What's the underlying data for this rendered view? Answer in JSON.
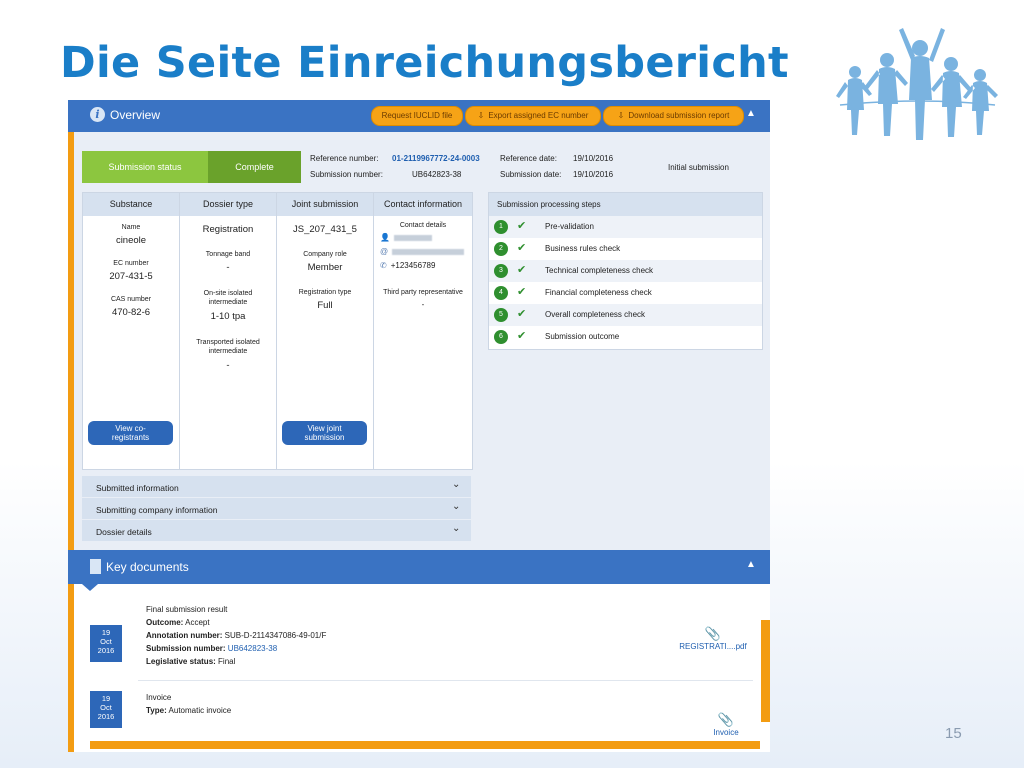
{
  "slide": {
    "title": "Die Seite Einreichungsbericht",
    "page_number": "15"
  },
  "overview": {
    "title": "Overview",
    "buttons": [
      "Request IUCLID file",
      "Export assigned EC number",
      "Download submission report"
    ],
    "status_label": "Submission status",
    "status_value": "Complete",
    "reference_number_label": "Reference number:",
    "reference_number": "01-2119967772-24-0003",
    "submission_number_label": "Submission number:",
    "submission_number": "UB642823-38",
    "reference_date_label": "Reference date:",
    "reference_date": "19/10/2016",
    "submission_date_label": "Submission date:",
    "submission_date": "19/10/2016",
    "submission_kind": "Initial submission"
  },
  "table": {
    "headers": [
      "Substance",
      "Dossier type",
      "Joint submission",
      "Contact information"
    ],
    "substance": {
      "name_label": "Name",
      "name": "cineole",
      "ec_label": "EC number",
      "ec": "207-431-5",
      "cas_label": "CAS number",
      "cas": "470-82-6",
      "button": "View co-registrants"
    },
    "dossier": {
      "type": "Registration",
      "tonnage_label": "Tonnage band",
      "tonnage": "-",
      "onsite_label": "On-site isolated intermediate",
      "onsite": "1-10 tpa",
      "transported_label": "Transported isolated intermediate",
      "transported": "-"
    },
    "joint": {
      "id": "JS_207_431_5",
      "role_label": "Company role",
      "role": "Member",
      "reg_type_label": "Registration type",
      "reg_type": "Full",
      "button": "View joint submission"
    },
    "contact": {
      "details_label": "Contact details",
      "phone": "+123456789",
      "third_party_label": "Third party representative",
      "third_party": "-"
    }
  },
  "accordions": [
    "Submitted information",
    "Submitting company information",
    "Dossier details"
  ],
  "steps": {
    "title": "Submission processing steps",
    "items": [
      {
        "num": "1",
        "label": "Pre-validation"
      },
      {
        "num": "2",
        "label": "Business rules check"
      },
      {
        "num": "3",
        "label": "Technical completeness check"
      },
      {
        "num": "4",
        "label": "Financial completeness check"
      },
      {
        "num": "5",
        "label": "Overall completeness check"
      },
      {
        "num": "6",
        "label": "Submission outcome"
      }
    ]
  },
  "key_documents": {
    "title": "Key documents",
    "doc1": {
      "day": "19",
      "month": "Oct",
      "year": "2016",
      "title": "Final submission result",
      "outcome_label": "Outcome:",
      "outcome": "Accept",
      "annotation_label": "Annotation number:",
      "annotation": "SUB-D-2114347086-49-01/F",
      "submission_label": "Submission number:",
      "submission": "UB642823-38",
      "legislative_label": "Legislative status:",
      "legislative": "Final",
      "attachment": "REGISTRATI....pdf"
    },
    "doc2": {
      "day": "19",
      "month": "Oct",
      "year": "2016",
      "title": "Invoice",
      "type_label": "Type:",
      "type": "Automatic invoice",
      "attachment": "Invoice"
    }
  },
  "colors": {
    "title_blue": "#1a7ec8",
    "header_blue": "#3a73c3",
    "orange": "#f39c12",
    "green_light": "#8cc63f",
    "green_dark": "#6aa22b",
    "step_green": "#2f8f2f"
  }
}
